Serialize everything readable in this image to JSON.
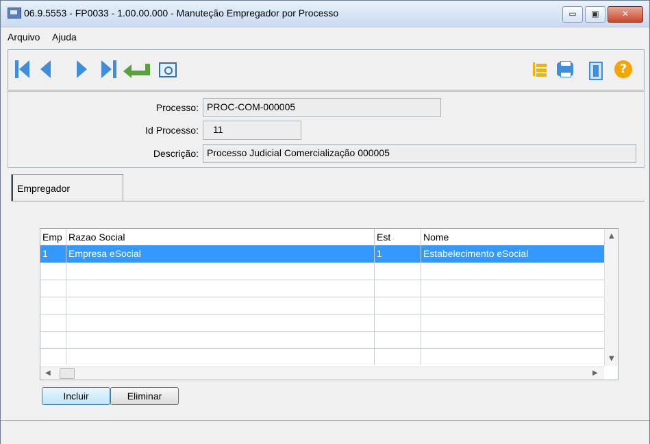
{
  "window": {
    "title": "06.9.5553 - FP0033 - 1.00.00.000 - Manuteção Empregador por Processo",
    "controls": {
      "minimize": "▭",
      "maximize": "▣",
      "close": "✕"
    }
  },
  "menu": {
    "items": [
      "Arquivo",
      "Ajuda"
    ]
  },
  "toolbar": {
    "left_icons": [
      "first-icon",
      "previous-icon",
      "next-icon",
      "last-icon",
      "enter-icon",
      "zoom-icon"
    ],
    "right_icons": [
      "tree-icon",
      "printer-icon",
      "exit-icon",
      "help-icon"
    ],
    "help_glyph": "?"
  },
  "form": {
    "processo_label": "Processo:",
    "processo_value": "PROC-COM-000005",
    "id_processo_label": "Id Processo:",
    "id_processo_value": "11",
    "descricao_label": "Descrição:",
    "descricao_value": "Processo Judicial Comercialização 000005"
  },
  "tabs": [
    "Empregador"
  ],
  "grid": {
    "columns": [
      "Emp",
      "Razao Social",
      "Est",
      "Nome"
    ],
    "rows": [
      {
        "emp": "1",
        "razao": "Empresa eSocial",
        "est": "1",
        "nome": "Estabelecimento eSocial"
      }
    ]
  },
  "buttons": {
    "incluir": "Incluir",
    "eliminar": "Eliminar"
  }
}
